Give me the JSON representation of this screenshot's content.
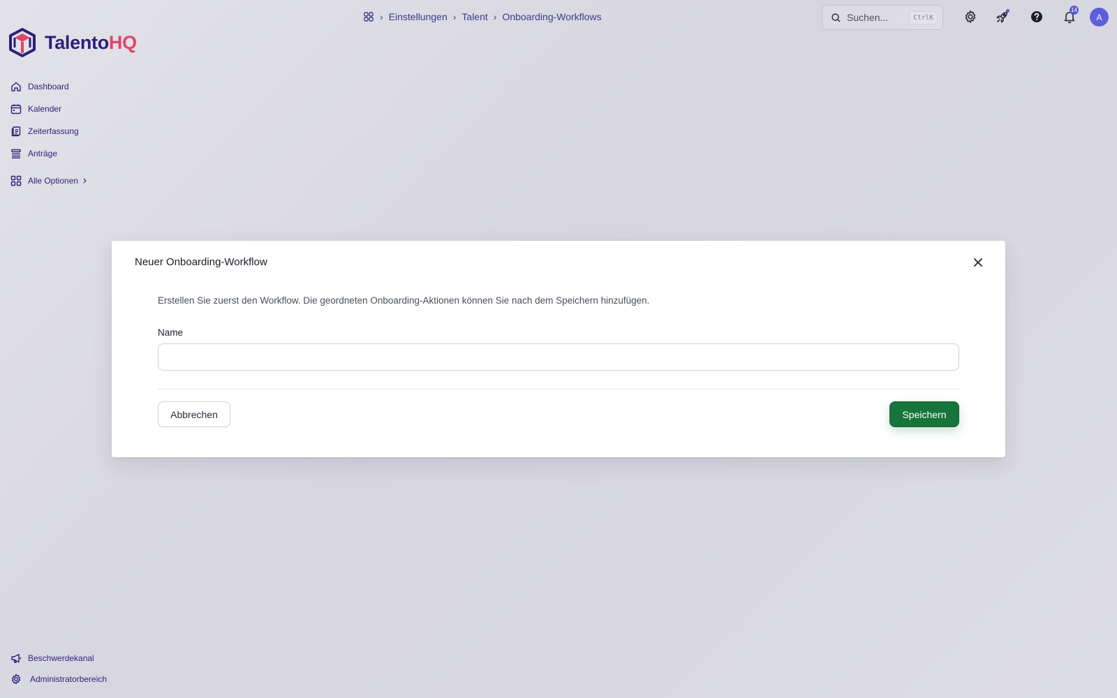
{
  "brand": {
    "name_part1": "Talento",
    "name_part2": "HQ",
    "primary_color": "#2d1f7a",
    "accent_color": "#e0456a"
  },
  "breadcrumb": {
    "home_icon": "grid-icon",
    "items": [
      "Einstellungen",
      "Talent",
      "Onboarding-Workflows"
    ]
  },
  "search": {
    "placeholder": "Suchen...",
    "shortcut": "CtrlK"
  },
  "topbar": {
    "icons": [
      "gear-icon",
      "rocket-icon",
      "help-icon",
      "bell-icon"
    ],
    "notification_count": "14",
    "avatar_initial": "A"
  },
  "sidebar": {
    "items": [
      {
        "label": "Dashboard",
        "icon": "home-icon"
      },
      {
        "label": "Kalender",
        "icon": "calendar-icon"
      },
      {
        "label": "Zeiterfassung",
        "icon": "clipboard-icon"
      },
      {
        "label": "Anträge",
        "icon": "list-icon"
      }
    ],
    "all_options": {
      "label": "Alle Optionen",
      "icon": "grid-icon"
    },
    "bottom": [
      {
        "label": "Beschwerdekanal",
        "icon": "megaphone-icon"
      },
      {
        "label": "Administratorbereich",
        "icon": "gear-icon"
      }
    ]
  },
  "modal": {
    "title": "Neuer Onboarding-Workflow",
    "description": "Erstellen Sie zuerst den Workflow. Die geordneten Onboarding-Aktionen können Sie nach dem Speichern hinzufügen.",
    "name_label": "Name",
    "name_value": "",
    "cancel_label": "Abbrechen",
    "save_label": "Speichern",
    "save_color": "#17743a"
  }
}
